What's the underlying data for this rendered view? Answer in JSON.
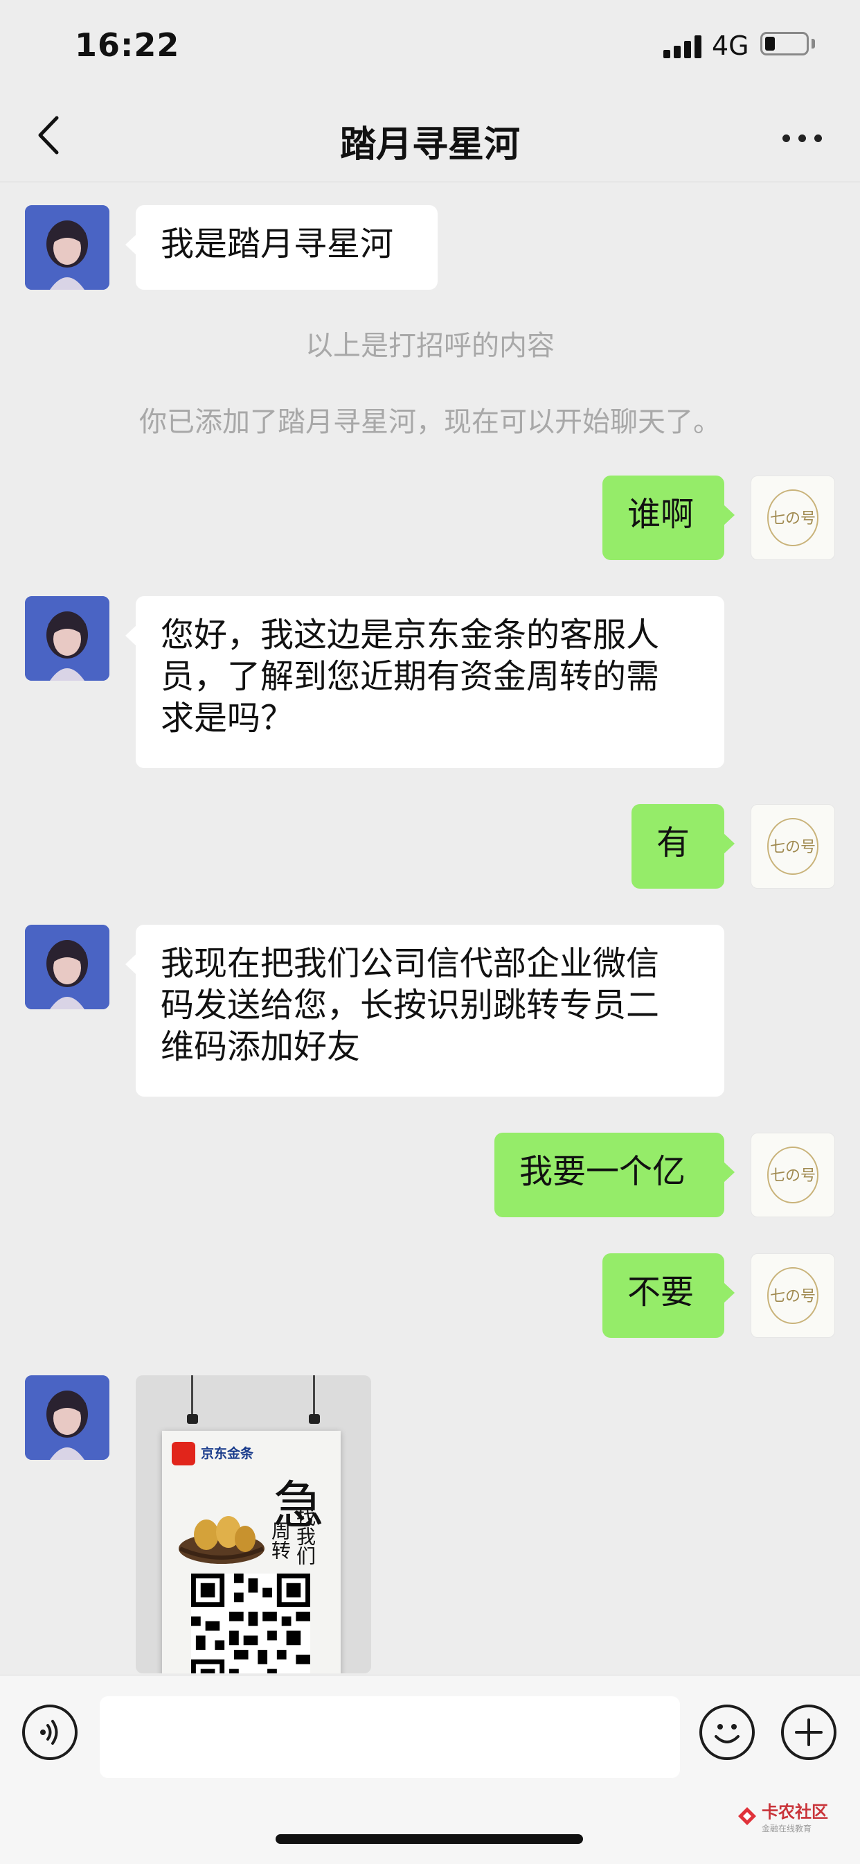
{
  "status_bar": {
    "time": "16:22",
    "network": "4G"
  },
  "nav": {
    "title": "踏月寻星河"
  },
  "messages": [
    {
      "from": "peer",
      "text": "我是踏月寻星河"
    },
    {
      "from": "system",
      "text": "以上是打招呼的内容"
    },
    {
      "from": "system",
      "text": "你已添加了踏月寻星河，现在可以开始聊天了。"
    },
    {
      "from": "me",
      "text": "谁啊"
    },
    {
      "from": "peer",
      "lines": [
        "您好，我这边是京东金条的客服人",
        "员，了解到您近期有资金周转的需",
        "求是吗？"
      ]
    },
    {
      "from": "me",
      "text": "有"
    },
    {
      "from": "peer",
      "lines": [
        "我现在把我们公司信代部企业微信",
        "码发送给您，长按识别跳转专员二",
        "维码添加好友"
      ]
    },
    {
      "from": "me",
      "text": "我要一个亿"
    },
    {
      "from": "me",
      "text": "不要"
    },
    {
      "from": "peer",
      "type": "image",
      "poster": {
        "brand": "京东金条",
        "big_char": "急",
        "line1": "找我们",
        "line2": "周转"
      }
    }
  ],
  "my_avatar_text": "七の号",
  "input_bar": {
    "placeholder": ""
  },
  "watermark": {
    "text": "卡农社区",
    "sub": "金融在线教育"
  },
  "colors": {
    "background": "#ededed",
    "incoming_bubble": "#ffffff",
    "outgoing_bubble": "#95ec69",
    "system_text": "#a8a8a8"
  }
}
